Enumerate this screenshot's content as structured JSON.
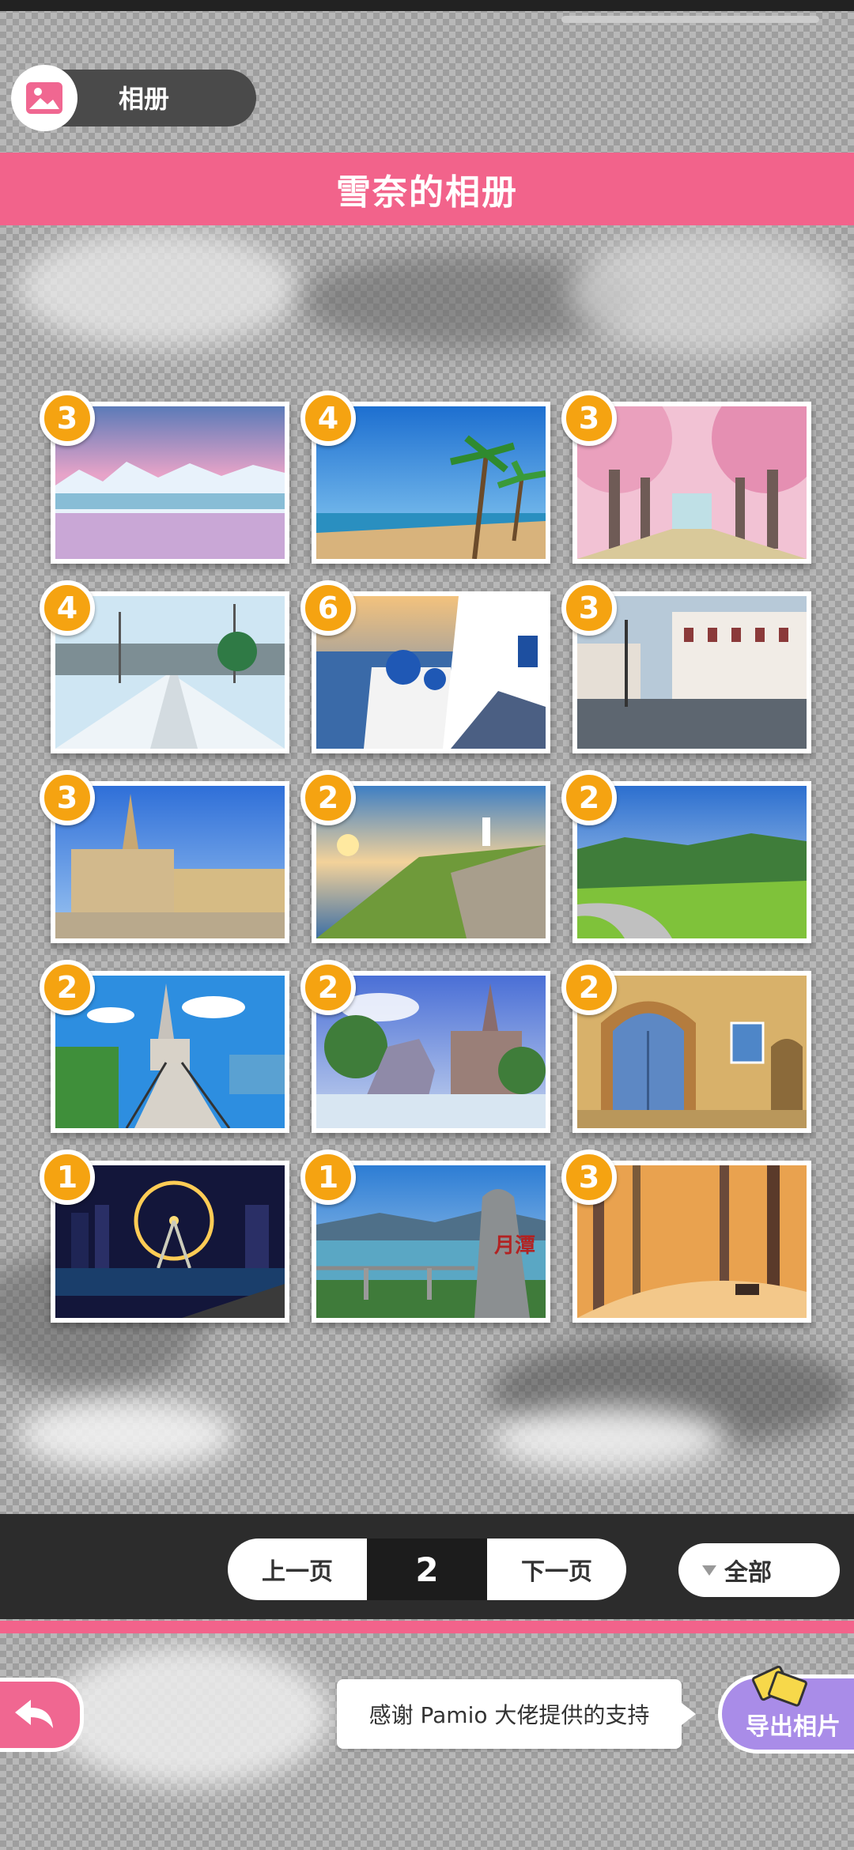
{
  "header": {
    "album_tag_label": "相册",
    "title": "雪奈的相册"
  },
  "photos": [
    {
      "count": "3",
      "scene": "iceberg-lagoon-sunset"
    },
    {
      "count": "4",
      "scene": "tropical-beach-palms"
    },
    {
      "count": "3",
      "scene": "cherry-blossom-avenue"
    },
    {
      "count": "4",
      "scene": "snowy-railway-station"
    },
    {
      "count": "6",
      "scene": "santorini-blue-domes"
    },
    {
      "count": "3",
      "scene": "european-town-square-rain"
    },
    {
      "count": "3",
      "scene": "gothic-town-hall"
    },
    {
      "count": "2",
      "scene": "lighthouse-cliff-sunrise"
    },
    {
      "count": "2",
      "scene": "green-hills-road"
    },
    {
      "count": "2",
      "scene": "church-by-lake"
    },
    {
      "count": "2",
      "scene": "fountain-statue-church"
    },
    {
      "count": "2",
      "scene": "blue-door-cottage"
    },
    {
      "count": "1",
      "scene": "ferris-wheel-night"
    },
    {
      "count": "1",
      "scene": "sun-moon-lake-stone"
    },
    {
      "count": "3",
      "scene": "autumn-forest-path"
    }
  ],
  "pagination": {
    "prev_label": "上一页",
    "current_page": "2",
    "next_label": "下一页"
  },
  "filter": {
    "label": "全部"
  },
  "footer": {
    "tooltip": "感谢 Pamio 大佬提供的支持",
    "export_label": "导出相片"
  },
  "colors": {
    "accent_pink": "#f2638b",
    "badge_orange": "#f5a311",
    "export_purple": "#a98ce8"
  }
}
